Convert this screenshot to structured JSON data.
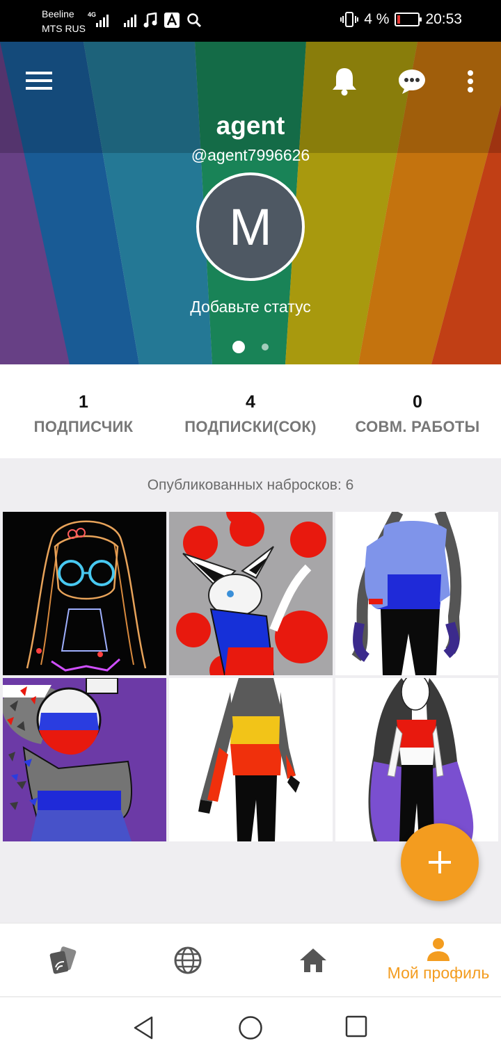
{
  "status_bar": {
    "carrier1": "Beeline",
    "carrier2": "MTS RUS",
    "network": "4G",
    "battery": "4 %",
    "time": "20:53"
  },
  "header": {
    "name": "agent",
    "handle": "@agent7996626",
    "avatar_letter": "M",
    "status_prompt": "Добавьте статус",
    "page_dots": 2,
    "active_dot": 0,
    "icons": [
      "menu-icon",
      "bell-icon",
      "chat-icon",
      "more-vert-icon"
    ]
  },
  "stats": [
    {
      "value": "1",
      "label": "ПОДПИСЧИК"
    },
    {
      "value": "4",
      "label": "ПОДПИСКИ(СОК)"
    },
    {
      "value": "0",
      "label": "СОВМ. РАБОТЫ"
    }
  ],
  "published_text": "Опубликованных набросков: 6",
  "artworks_count": 6,
  "bottom_nav": {
    "items": [
      {
        "icon": "cards-icon",
        "label": ""
      },
      {
        "icon": "globe-icon",
        "label": ""
      },
      {
        "icon": "home-icon",
        "label": ""
      },
      {
        "icon": "person-icon",
        "label": "Мой профиль",
        "active": true
      }
    ]
  },
  "colors": {
    "accent": "#f39c1f",
    "stat_label": "#777777",
    "content_bg": "#efeef1",
    "avatar_bg": "#4e5863"
  }
}
